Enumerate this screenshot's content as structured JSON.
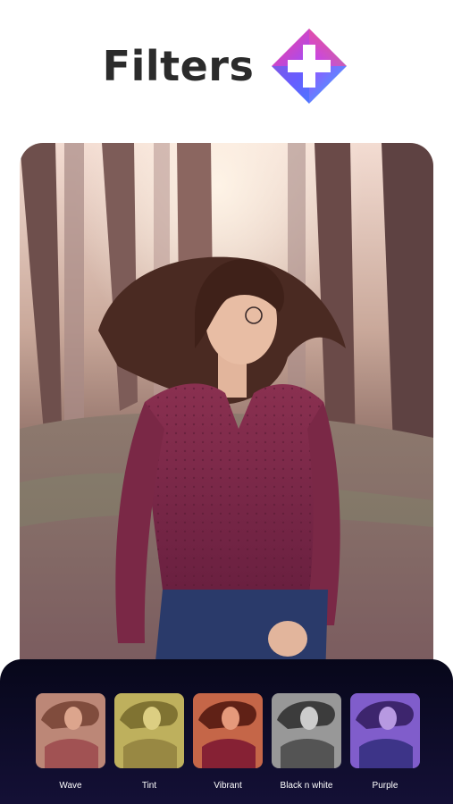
{
  "header": {
    "title": "Filters",
    "logo_icon": "diamond-plus-logo-icon"
  },
  "preview": {
    "icon": "portrait-photo-preview"
  },
  "filters": [
    {
      "label": "Wave",
      "tint": "#c8806a"
    },
    {
      "label": "Tint",
      "tint": "#c8c04a"
    },
    {
      "label": "Vibrant",
      "tint": "#b8422a"
    },
    {
      "label": "Black n white",
      "tint": "#8a8a8a"
    },
    {
      "label": "Purple",
      "tint": "#6a3fc0"
    }
  ],
  "colors": {
    "panel_bg": "#0b0a22",
    "title": "#2b2b2b",
    "sweater": "#7a2a48"
  }
}
